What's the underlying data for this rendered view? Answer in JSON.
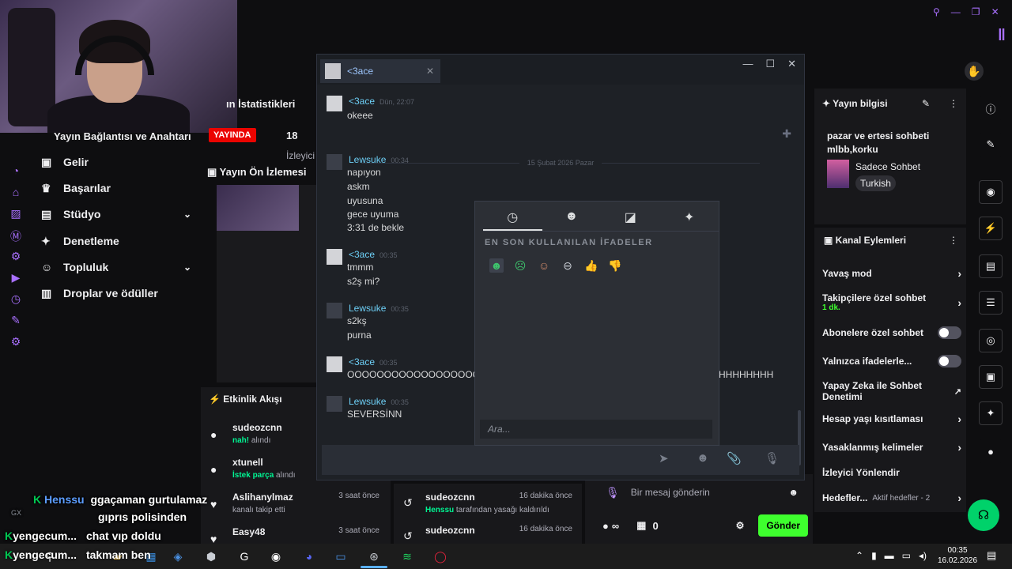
{
  "stream": {
    "stats_title": "ın İstatistikleri",
    "connection_title": "Yayın Bağlantısı ve Anahtarı",
    "live_badge": "YAYINDA",
    "viewers_value": "18",
    "viewers_label": "İzleyici",
    "preview_title": "Yayın Ön İzlemesi"
  },
  "nav": {
    "items": [
      {
        "label": "Gelir",
        "icon": "money-icon"
      },
      {
        "label": "Başarılar",
        "icon": "trophy-icon"
      },
      {
        "label": "Stüdyo",
        "icon": "studio-icon"
      },
      {
        "label": "Denetleme",
        "icon": "wrench-icon"
      },
      {
        "label": "Topluluk",
        "icon": "community-icon"
      },
      {
        "label": "Droplar ve ödüller",
        "icon": "drops-icon"
      }
    ]
  },
  "activity": {
    "title": "Etkinlik Akışı",
    "items": [
      {
        "name": "sudeozcnn",
        "highlight": "nah!",
        "desc": " alındı",
        "time": ""
      },
      {
        "name": "xtunell",
        "highlight": "İstek parça",
        "desc": " alındı",
        "time": ""
      },
      {
        "name": "Aslihanylmaz",
        "highlight": "",
        "desc": "kanalı takip etti",
        "time": "3 saat önce"
      },
      {
        "name": "Easy48",
        "highlight": "",
        "desc": "",
        "time": "3 saat önce"
      }
    ]
  },
  "feed2": {
    "items": [
      {
        "name": "sudeozcnn",
        "highlight": "Henssu",
        "desc": " tarafından yasağı kaldırıldı",
        "time": "16 dakika önce"
      },
      {
        "name": "sudeozcnn",
        "highlight": "",
        "desc": "",
        "time": "16 dakika önce"
      }
    ]
  },
  "overlay_chat": {
    "lines": [
      {
        "user": "Henssu",
        "text": "ggaçaman gurtulamaz"
      },
      {
        "user": "",
        "text": "gıprıs polisinden"
      },
      {
        "user": "yengecum...",
        "text": "chat vıp doldu"
      },
      {
        "user": "yengecum...",
        "text": "takmam ben"
      }
    ],
    "gx_label": "GX"
  },
  "twitch_chat": {
    "placeholder": "Bir mesaj gönderin",
    "points": "∞",
    "gifts": "0",
    "send_label": "Gönder"
  },
  "stream_info": {
    "title": "Yayın bilgisi",
    "description": "pazar ve ertesi sohbeti mlbb,korku",
    "category": "Sadece Sohbet",
    "tag": "Turkish"
  },
  "channel_actions": {
    "title": "Kanal Eylemleri",
    "slow_mode": "Yavaş mod",
    "followers_only": "Takipçilere özel sohbet",
    "followers_only_value": "1 dk.",
    "subs_only": "Abonelere özel sohbet",
    "emotes_only": "Yalnızca ifadelerle...",
    "ai_moderation": "Yapay Zeka ile Sohbet Denetimi",
    "account_age": "Hesap yaşı kısıtlaması",
    "banned_words": "Yasaklanmış kelimeler",
    "viewer_redirect": "İzleyici Yönlendir",
    "goals": "Hedefler...",
    "goals_value": "Aktif hedefler - 2"
  },
  "steam": {
    "tab_name": "<3ace",
    "date_separator": "15 Şubat 2026 Pazar",
    "messages": [
      {
        "user": "<3ace",
        "time": "Dün, 22:07",
        "lines": [
          "okeee"
        ]
      },
      {
        "user": "Lewsuke",
        "time": "00:34",
        "lines": [
          "napıyon",
          "askm",
          "uyusuna",
          "gece uyuma",
          "3:31 de bekle"
        ]
      },
      {
        "user": "<3ace",
        "time": "00:35",
        "lines": [
          "tmmm",
          "s2ş mi?"
        ]
      },
      {
        "user": "Lewsuke",
        "time": "00:35",
        "lines": [
          "s2kş",
          "purna"
        ]
      },
      {
        "user": "<3ace",
        "time": "00:35",
        "lines": [
          "OOOOOOOOOOOOOOOOOO"
        ]
      },
      {
        "user": "Lewsuke",
        "time": "00:35",
        "lines": [
          "SEVERSİNN"
        ]
      }
    ],
    "overflow_text": "HHHHHHHH"
  },
  "emoticons": {
    "section_title": "EN SON KULLANILAN İFADELER",
    "search_placeholder": "Ara...",
    "tabs": [
      "recent-icon",
      "emoji-icon",
      "sticker-icon",
      "effects-icon"
    ]
  },
  "taskbar": {
    "time": "00:35",
    "date": "16.02.2026"
  },
  "colors": {
    "twitch_purple": "#a970ff",
    "live_red": "#eb0400",
    "send_green": "#3eff2e",
    "steam_name": "#6dcff6"
  }
}
